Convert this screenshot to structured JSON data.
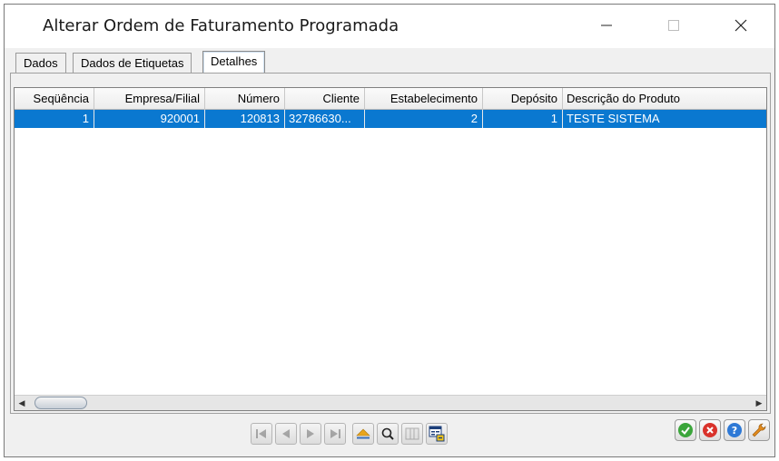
{
  "window": {
    "title": "Alterar Ordem de Faturamento Programada"
  },
  "tabs": [
    {
      "label": "Dados",
      "active": false
    },
    {
      "label": "Dados de Etiquetas",
      "active": false
    },
    {
      "label": "Detalhes",
      "active": true
    }
  ],
  "grid": {
    "columns": [
      "Seqüência",
      "Empresa/Filial",
      "Número",
      "Cliente",
      "Estabelecimento",
      "Depósito",
      "Descrição do Produto"
    ],
    "rows": [
      {
        "sequencia": "1",
        "empresa_filial": "920001",
        "numero": "120813",
        "cliente": "32786630...",
        "estabelecimento": "2",
        "deposito": "1",
        "descricao": "TESTE SISTEMA",
        "selected": true
      }
    ]
  },
  "navigation": {
    "buttons": [
      "first-icon",
      "previous-icon",
      "next-icon",
      "last-icon",
      "eject-icon",
      "search-icon",
      "columns-icon",
      "export-icon"
    ]
  },
  "actions": {
    "buttons": [
      "confirm-icon",
      "cancel-icon",
      "help-icon",
      "settings-icon"
    ]
  },
  "colors": {
    "selection": "#0a78d0",
    "confirm": "#3aa53a",
    "cancel": "#d9322b",
    "help": "#2e79d6",
    "settings": "#e28a1c"
  }
}
